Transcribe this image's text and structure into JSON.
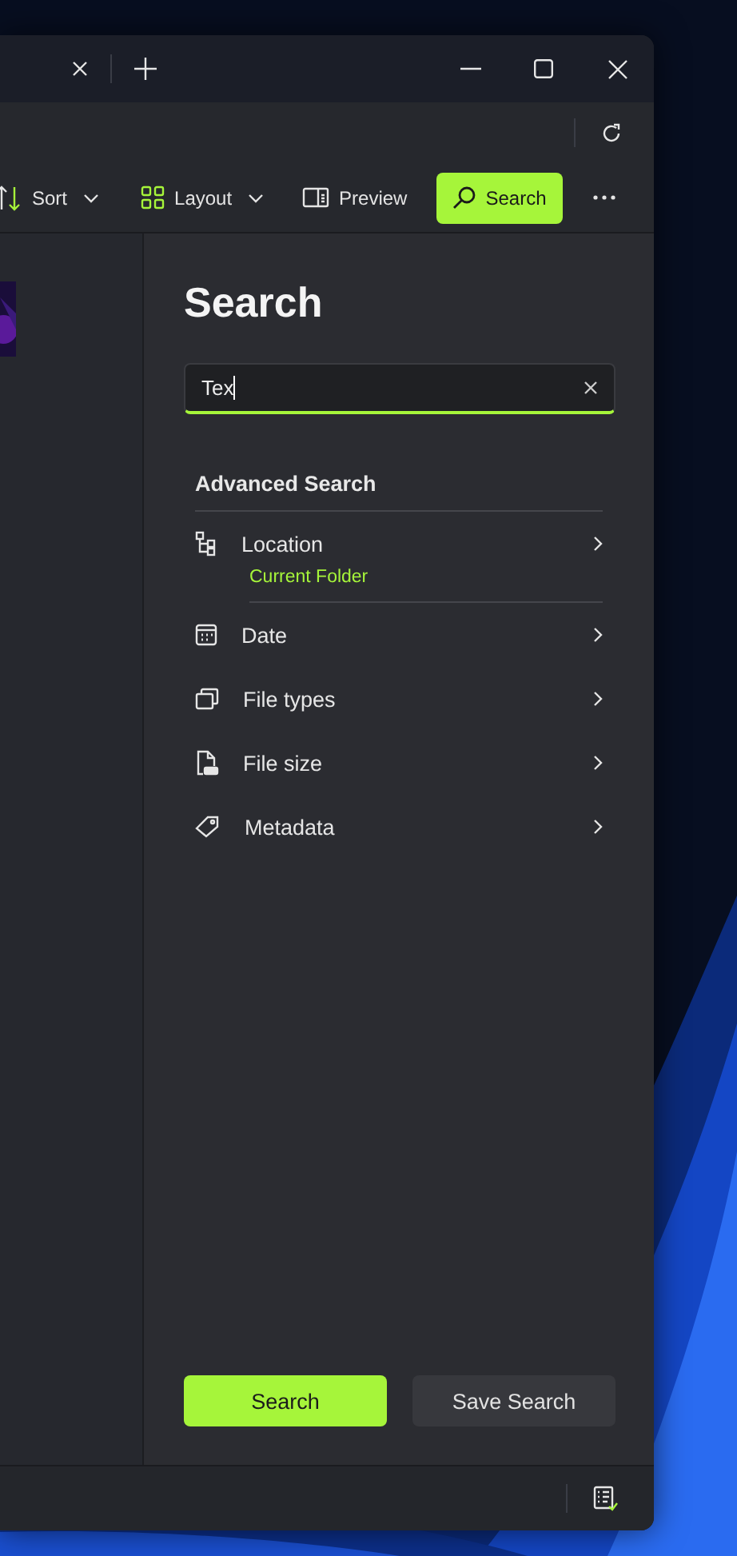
{
  "toolbar": {
    "items": [
      {
        "label": "Sort",
        "kind": "dropdown",
        "selected": false
      },
      {
        "label": "Layout",
        "kind": "dropdown",
        "selected": false
      },
      {
        "label": "Preview",
        "kind": "button",
        "selected": false
      },
      {
        "label": "Search",
        "kind": "button",
        "selected": true
      }
    ]
  },
  "search_pane": {
    "title": "Search",
    "field": {
      "value": "Tex"
    },
    "section_title": "Advanced Search",
    "filters": [
      {
        "label": "Location",
        "value": "Current Folder"
      },
      {
        "label": "Date"
      },
      {
        "label": "File types"
      },
      {
        "label": "File size"
      },
      {
        "label": "Metadata"
      }
    ],
    "buttons": [
      {
        "label": "Search",
        "kind": "primary"
      },
      {
        "label": "Save Search",
        "kind": "secondary"
      }
    ]
  }
}
